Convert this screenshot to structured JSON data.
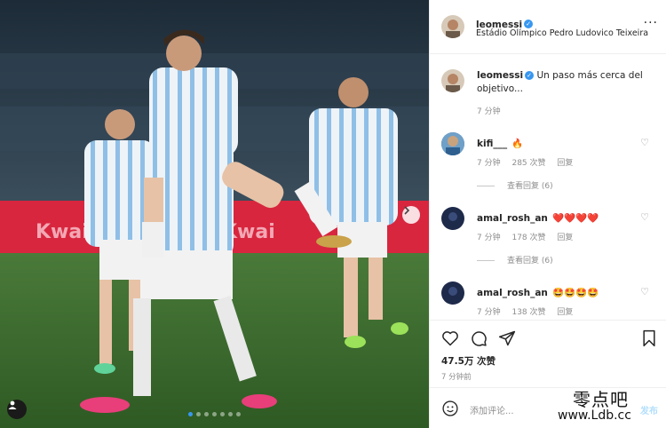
{
  "post": {
    "username": "leomessi",
    "location": "Estádio Olímpico Pedro Ludovico Teixeira",
    "more_icon": "ellipsis-icon",
    "caption": "Un paso más cerca del objetivo...",
    "caption_time": "7 分钟",
    "carousel_dots": 7,
    "carousel_active_index": 0
  },
  "comments": [
    {
      "user": "kifi___",
      "text": "🔥",
      "time": "7 分钟",
      "likes": "285 次赞",
      "reply": "回复",
      "view_replies": "查看回复 (6)"
    },
    {
      "user": "amal_rosh_an",
      "text": "❤️❤️❤️❤️",
      "time": "7 分钟",
      "likes": "178 次赞",
      "reply": "回复",
      "view_replies": "查看回复 (6)"
    },
    {
      "user": "amal_rosh_an",
      "text": "🤩🤩🤩🤩",
      "time": "7 分钟",
      "likes": "138 次赞",
      "reply": "回复"
    }
  ],
  "actions": {
    "likes": "47.5万 次赞",
    "ago": "7 分钟前"
  },
  "composer": {
    "placeholder": "添加评论...",
    "post_label": "发布"
  },
  "watermark": {
    "cn": "零点吧",
    "url": "www.Ldb.cc"
  },
  "colors": {
    "accent": "#3897f0",
    "muted": "#8e8e8e",
    "border": "#efefef",
    "jersey_blue": "#74acdf"
  }
}
